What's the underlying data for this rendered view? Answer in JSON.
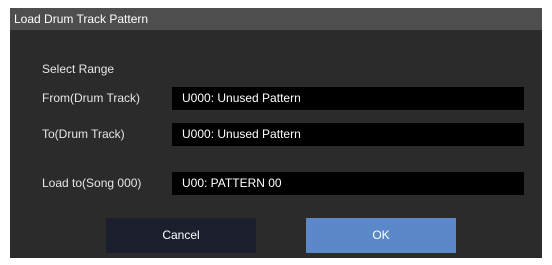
{
  "dialog": {
    "title": "Load Drum Track Pattern",
    "section_label": "Select Range",
    "rows": [
      {
        "label": "From(Drum Track)",
        "value": "U000: Unused Pattern"
      },
      {
        "label": "To(Drum Track)",
        "value": "U000: Unused Pattern"
      },
      {
        "label": "Load to(Song 000)",
        "value": "U00: PATTERN 00"
      }
    ],
    "buttons": {
      "cancel_label": "Cancel",
      "ok_label": "OK"
    }
  },
  "colors": {
    "dialog_background": "#2b2b2b",
    "titlebar_background": "#4e4e4e",
    "field_background": "#000000",
    "ok_button": "#5a88c8",
    "cancel_button": "#1b1f2d"
  }
}
